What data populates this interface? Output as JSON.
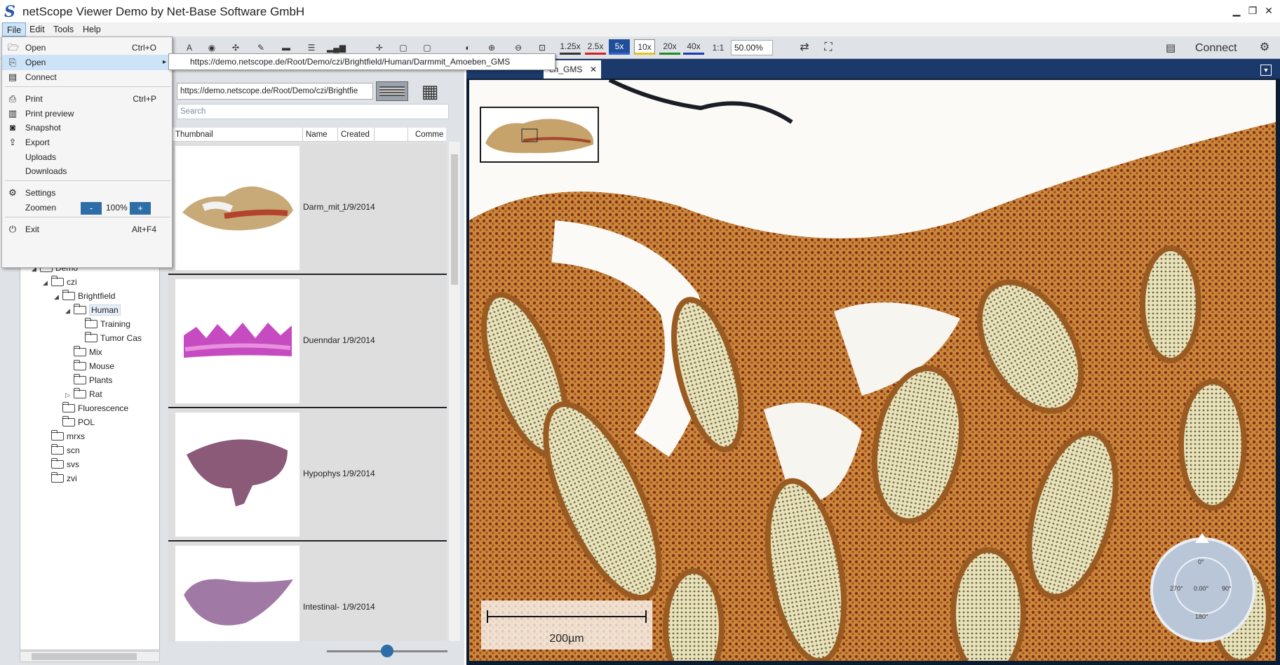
{
  "window": {
    "title": "netScope Viewer Demo by Net-Base Software GmbH",
    "logo": "S"
  },
  "menubar": [
    "File",
    "Edit",
    "Tools",
    "Help"
  ],
  "toolbar": {
    "zoom_levels": [
      "1.25x",
      "2.5x",
      "5x",
      "10x",
      "20x",
      "40x"
    ],
    "zoom_colors": [
      "#222222",
      "#d62020",
      "#3a62c9",
      "#e3c51e",
      "#1f8a2a",
      "#1d3ab6"
    ],
    "one_to_one": "1:1",
    "zoom_value": "50.00%",
    "connect_label": "Connect"
  },
  "file_menu": {
    "items": [
      {
        "icon": "folder-open-icon",
        "label": "Open",
        "shortcut": "Ctrl+O"
      },
      {
        "icon": "network-open-icon",
        "label": "Open",
        "shortcut": "",
        "submenu_arrow": "▸"
      },
      {
        "icon": "server-icon",
        "label": "Connect",
        "shortcut": ""
      },
      {
        "icon": "printer-icon",
        "label": "Print",
        "shortcut": "Ctrl+P"
      },
      {
        "icon": "print-preview-icon",
        "label": "Print preview",
        "shortcut": ""
      },
      {
        "icon": "camera-icon",
        "label": "Snapshot",
        "shortcut": ""
      },
      {
        "icon": "export-icon",
        "label": "Export",
        "shortcut": ""
      },
      {
        "icon": "",
        "label": "Uploads",
        "shortcut": ""
      },
      {
        "icon": "",
        "label": "Downloads",
        "shortcut": ""
      },
      {
        "icon": "gear-icon",
        "label": "Settings",
        "shortcut": ""
      },
      {
        "icon": "",
        "label": "Zoomen",
        "shortcut": ""
      },
      {
        "icon": "power-icon",
        "label": "Exit",
        "shortcut": "Alt+F4"
      }
    ],
    "zoom": {
      "minus": "-",
      "value": "100%",
      "plus": "+"
    }
  },
  "submenu": {
    "url": "https://demo.netscope.de/Root/Demo/czi/Brightfield/Human/Darmmit_Amoeben_GMS"
  },
  "tree": {
    "nodes": [
      {
        "label": "Demo",
        "depth": 1,
        "arrow": "◢"
      },
      {
        "label": "czi",
        "depth": 2,
        "arrow": "◢"
      },
      {
        "label": "Brightfield",
        "depth": 3,
        "arrow": "◢"
      },
      {
        "label": "Human",
        "depth": 4,
        "arrow": "◢"
      },
      {
        "label": "Training",
        "depth": 5,
        "arrow": ""
      },
      {
        "label": "Tumor Cas",
        "depth": 5,
        "arrow": ""
      },
      {
        "label": "Mix",
        "depth": 4,
        "arrow": ""
      },
      {
        "label": "Mouse",
        "depth": 4,
        "arrow": ""
      },
      {
        "label": "Plants",
        "depth": 4,
        "arrow": ""
      },
      {
        "label": "Rat",
        "depth": 4,
        "arrow": "▷"
      },
      {
        "label": "Fluorescence",
        "depth": 3,
        "arrow": ""
      },
      {
        "label": "POL",
        "depth": 3,
        "arrow": ""
      },
      {
        "label": "mrxs",
        "depth": 2,
        "arrow": ""
      },
      {
        "label": "scn",
        "depth": 2,
        "arrow": ""
      },
      {
        "label": "svs",
        "depth": 2,
        "arrow": ""
      },
      {
        "label": "zvi",
        "depth": 2,
        "arrow": ""
      }
    ]
  },
  "browser": {
    "path": "https://demo.netscope.de/Root/Demo/czi/Brightfie",
    "search_placeholder": "Search",
    "columns": [
      "Thumbnail",
      "Name",
      "Created",
      "Comme"
    ],
    "rows": [
      {
        "name": "Darm_mit_",
        "created": "1/9/2014"
      },
      {
        "name": "Duenndar",
        "created": "1/9/2014"
      },
      {
        "name": "Hypophys",
        "created": "1/9/2014"
      },
      {
        "name": "Intestinal-",
        "created": "1/9/2014"
      }
    ]
  },
  "viewer": {
    "tab_label": "en_GMS",
    "tab_close": "✕",
    "scale_label": "200µm",
    "compass": {
      "top": "0°",
      "left": "270°",
      "center": "0.00°",
      "right": "90°",
      "bottom": "180°"
    }
  }
}
